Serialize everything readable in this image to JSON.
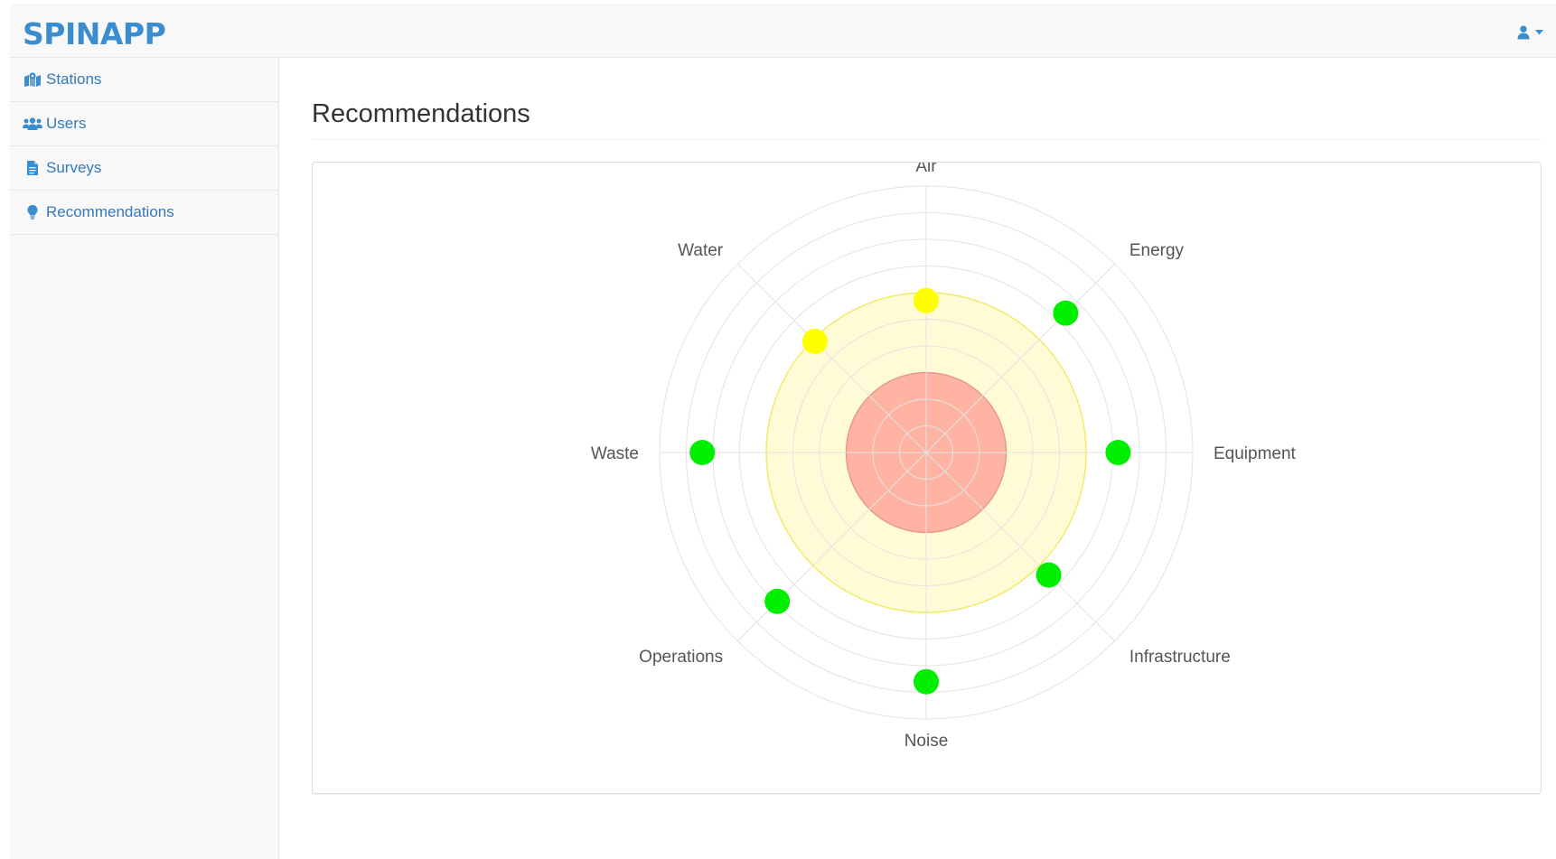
{
  "app": {
    "brand": "SPINAPP"
  },
  "header": {
    "user_icon": "user-icon",
    "caret_icon": "caret-down-icon"
  },
  "sidebar": {
    "items": [
      {
        "label": "Stations",
        "icon": "map-marker-icon"
      },
      {
        "label": "Users",
        "icon": "users-icon"
      },
      {
        "label": "Surveys",
        "icon": "file-icon"
      },
      {
        "label": "Recommendations",
        "icon": "lightbulb-icon"
      }
    ]
  },
  "main": {
    "title": "Recommendations"
  },
  "chart_data": {
    "type": "polar-scatter",
    "title": "",
    "categories": [
      "Air",
      "Energy",
      "Equipment",
      "Infrastructure",
      "Noise",
      "Operations",
      "Waste",
      "Water"
    ],
    "values": [
      5.7,
      7.4,
      7.2,
      6.5,
      8.6,
      7.9,
      8.4,
      5.9
    ],
    "point_colors": [
      "#ffff00",
      "#00ee00",
      "#00ee00",
      "#00ee00",
      "#00ee00",
      "#00ee00",
      "#00ee00",
      "#ffff00"
    ],
    "rlim": [
      0,
      10
    ],
    "grid_rings": 10,
    "zones": [
      {
        "from": 0,
        "to": 3,
        "color": "#ffb3a3"
      },
      {
        "from": 3,
        "to": 6,
        "color": "#fffbd6"
      }
    ],
    "grid": true,
    "legend": "none"
  }
}
